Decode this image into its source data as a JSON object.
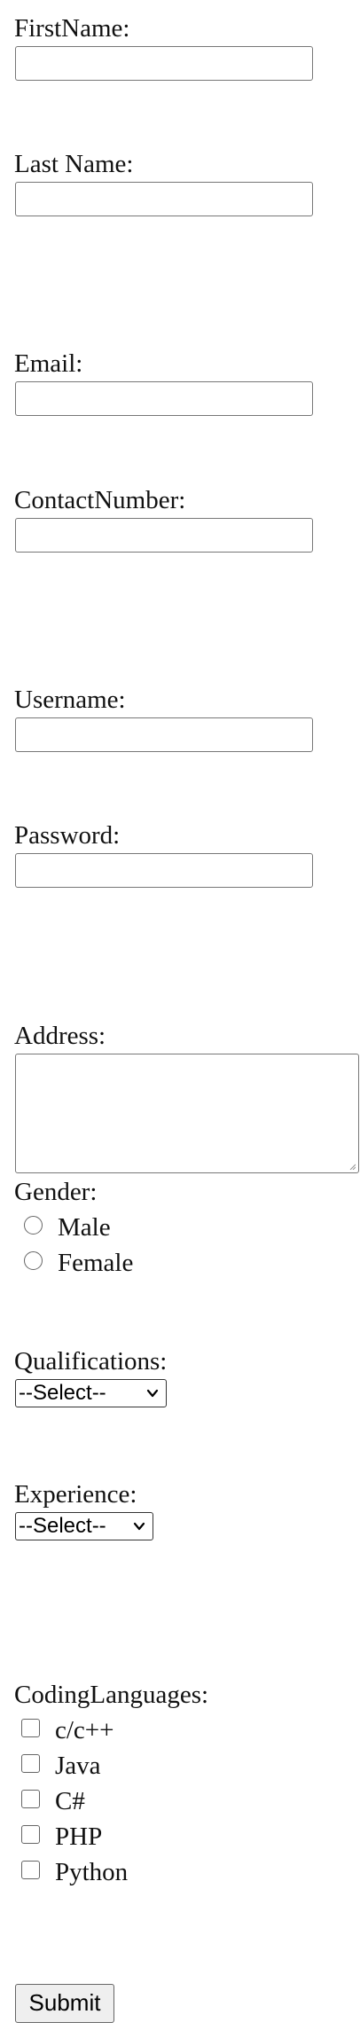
{
  "form": {
    "first_name_label": "FirstName:",
    "first_name_value": "",
    "last_name_label": "Last Name:",
    "last_name_value": "",
    "email_label": "Email:",
    "email_value": "",
    "contact_number_label": "ContactNumber:",
    "contact_number_value": "",
    "username_label": "Username:",
    "username_value": "",
    "password_label": "Password:",
    "password_value": "",
    "address_label": "Address:",
    "address_value": "",
    "gender": {
      "label": "Gender:",
      "options": [
        "Male",
        "Female"
      ],
      "selected": null
    },
    "qualifications": {
      "label": "Qualifications:",
      "selected": "--Select--"
    },
    "experience": {
      "label": "Experience:",
      "selected": "--Select--"
    },
    "coding_languages": {
      "label": "CodingLanguages:",
      "options": [
        "c/c++",
        "Java",
        "C#",
        "PHP",
        "Python"
      ],
      "checked": [
        false,
        false,
        false,
        false,
        false
      ]
    },
    "submit_label": "Submit"
  },
  "colors": {
    "background": "#ffffff",
    "text": "#111111",
    "input_border": "#777777",
    "button_background": "#efefef"
  },
  "icons": {
    "select_chevron": "chevron-down-icon",
    "textarea_grip": "resize-grip-icon"
  }
}
